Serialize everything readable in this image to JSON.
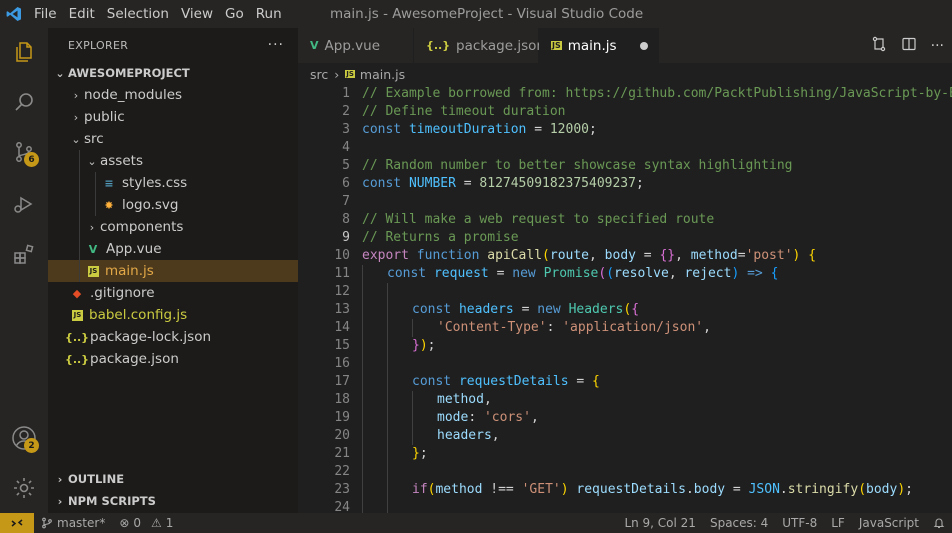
{
  "titlebar": {
    "menu": [
      "File",
      "Edit",
      "Selection",
      "View",
      "Go",
      "Run"
    ],
    "window_title": "main.js - AwesomeProject - Visual Studio Code"
  },
  "activity": {
    "scm_badge": "6",
    "accounts_badge": "2"
  },
  "sidebar": {
    "header": "EXPLORER",
    "more": "···",
    "project": "AWESOMEPROJECT",
    "tree": [
      {
        "label": "node_modules",
        "kind": "folder",
        "depth": 1,
        "open": false
      },
      {
        "label": "public",
        "kind": "folder",
        "depth": 1,
        "open": false
      },
      {
        "label": "src",
        "kind": "folder",
        "depth": 1,
        "open": true
      },
      {
        "label": "assets",
        "kind": "folder",
        "depth": 2,
        "open": true
      },
      {
        "label": "styles.css",
        "kind": "css",
        "depth": 3
      },
      {
        "label": "logo.svg",
        "kind": "svg",
        "depth": 3
      },
      {
        "label": "components",
        "kind": "folder",
        "depth": 2,
        "open": false
      },
      {
        "label": "App.vue",
        "kind": "vue",
        "depth": 2
      },
      {
        "label": "main.js",
        "kind": "js",
        "depth": 2,
        "selected": true
      },
      {
        "label": ".gitignore",
        "kind": "git",
        "depth": 1
      },
      {
        "label": "babel.config.js",
        "kind": "js",
        "depth": 1
      },
      {
        "label": "package-lock.json",
        "kind": "json",
        "depth": 1
      },
      {
        "label": "package.json",
        "kind": "json",
        "depth": 1
      }
    ],
    "sections": [
      "OUTLINE",
      "NPM SCRIPTS"
    ]
  },
  "tabs": [
    {
      "label": "App.vue",
      "icon": "vue-icon"
    },
    {
      "label": "package.json",
      "icon": "json-icon"
    },
    {
      "label": "main.js",
      "icon": "js-icon",
      "active": true,
      "modified": true
    }
  ],
  "breadcrumb": {
    "folder": "src",
    "sep": "›",
    "file": "main.js"
  },
  "editor": {
    "current_line": 9,
    "lines": [
      {
        "n": "1",
        "indent": 0,
        "toks": [
          [
            "com",
            "// Example borrowed from: https://github.com/PacktPublishing/JavaScript-by-Example"
          ]
        ]
      },
      {
        "n": "2",
        "indent": 0,
        "toks": [
          [
            "com",
            "// Define timeout duration"
          ]
        ]
      },
      {
        "n": "3",
        "indent": 0,
        "toks": [
          [
            "kw",
            "const "
          ],
          [
            "const",
            "timeoutDuration"
          ],
          [
            "pun",
            " = "
          ],
          [
            "num",
            "12000"
          ],
          [
            "pun",
            ";"
          ]
        ]
      },
      {
        "n": "4",
        "indent": 0,
        "toks": []
      },
      {
        "n": "5",
        "indent": 0,
        "toks": [
          [
            "com",
            "// Random number to better showcase syntax highlighting"
          ]
        ]
      },
      {
        "n": "6",
        "indent": 0,
        "toks": [
          [
            "kw",
            "const "
          ],
          [
            "const",
            "NUMBER"
          ],
          [
            "pun",
            " = "
          ],
          [
            "num",
            "81274509182375409237"
          ],
          [
            "pun",
            ";"
          ]
        ]
      },
      {
        "n": "7",
        "indent": 0,
        "toks": []
      },
      {
        "n": "8",
        "indent": 0,
        "toks": [
          [
            "com",
            "// Will make a web request to specified route"
          ]
        ]
      },
      {
        "n": "9",
        "indent": 0,
        "toks": [
          [
            "com",
            "// Returns a promise"
          ]
        ]
      },
      {
        "n": "10",
        "indent": 0,
        "toks": [
          [
            "ctl",
            "export "
          ],
          [
            "kw",
            "function "
          ],
          [
            "fn",
            "apiCall"
          ],
          [
            "br1",
            "("
          ],
          [
            "var",
            "route"
          ],
          [
            "pun",
            ", "
          ],
          [
            "var",
            "body"
          ],
          [
            "pun",
            " = "
          ],
          [
            "br2",
            "{}"
          ],
          [
            "pun",
            ", "
          ],
          [
            "var",
            "method"
          ],
          [
            "pun",
            "="
          ],
          [
            "str",
            "'post'"
          ],
          [
            "br1",
            ")"
          ],
          [
            "pun",
            " "
          ],
          [
            "br1",
            "{"
          ]
        ]
      },
      {
        "n": "11",
        "indent": 1,
        "toks": [
          [
            "kw",
            "const "
          ],
          [
            "const",
            "request"
          ],
          [
            "pun",
            " = "
          ],
          [
            "kw",
            "new "
          ],
          [
            "cls",
            "Promise"
          ],
          [
            "br2",
            "("
          ],
          [
            "br3",
            "("
          ],
          [
            "var",
            "resolve"
          ],
          [
            "pun",
            ", "
          ],
          [
            "var",
            "reject"
          ],
          [
            "br3",
            ")"
          ],
          [
            "pun",
            " "
          ],
          [
            "kw",
            "=>"
          ],
          [
            "pun",
            " "
          ],
          [
            "br3",
            "{"
          ]
        ]
      },
      {
        "n": "12",
        "indent": 2,
        "toks": []
      },
      {
        "n": "13",
        "indent": 2,
        "toks": [
          [
            "kw",
            "const "
          ],
          [
            "const",
            "headers"
          ],
          [
            "pun",
            " = "
          ],
          [
            "kw",
            "new "
          ],
          [
            "cls",
            "Headers"
          ],
          [
            "br1",
            "("
          ],
          [
            "br2",
            "{"
          ]
        ]
      },
      {
        "n": "14",
        "indent": 3,
        "toks": [
          [
            "str",
            "'Content-Type'"
          ],
          [
            "pun",
            ": "
          ],
          [
            "str",
            "'application/json'"
          ],
          [
            "pun",
            ","
          ]
        ]
      },
      {
        "n": "15",
        "indent": 2,
        "toks": [
          [
            "br2",
            "}"
          ],
          [
            "br1",
            ")"
          ],
          [
            "pun",
            ";"
          ]
        ]
      },
      {
        "n": "16",
        "indent": 2,
        "toks": []
      },
      {
        "n": "17",
        "indent": 2,
        "toks": [
          [
            "kw",
            "const "
          ],
          [
            "const",
            "requestDetails"
          ],
          [
            "pun",
            " = "
          ],
          [
            "br1",
            "{"
          ]
        ]
      },
      {
        "n": "18",
        "indent": 3,
        "toks": [
          [
            "var",
            "method"
          ],
          [
            "pun",
            ","
          ]
        ]
      },
      {
        "n": "19",
        "indent": 3,
        "toks": [
          [
            "var",
            "mode"
          ],
          [
            "pun",
            ": "
          ],
          [
            "str",
            "'cors'"
          ],
          [
            "pun",
            ","
          ]
        ]
      },
      {
        "n": "20",
        "indent": 3,
        "toks": [
          [
            "var",
            "headers"
          ],
          [
            "pun",
            ","
          ]
        ]
      },
      {
        "n": "21",
        "indent": 2,
        "toks": [
          [
            "br1",
            "}"
          ],
          [
            "pun",
            ";"
          ]
        ]
      },
      {
        "n": "22",
        "indent": 2,
        "toks": []
      },
      {
        "n": "23",
        "indent": 2,
        "toks": [
          [
            "ctl",
            "if"
          ],
          [
            "br1",
            "("
          ],
          [
            "var",
            "method"
          ],
          [
            "pun",
            " !== "
          ],
          [
            "str",
            "'GET'"
          ],
          [
            "br1",
            ")"
          ],
          [
            "pun",
            " "
          ],
          [
            "var",
            "requestDetails"
          ],
          [
            "pun",
            "."
          ],
          [
            "var",
            "body"
          ],
          [
            "pun",
            " = "
          ],
          [
            "const",
            "JSON"
          ],
          [
            "pun",
            "."
          ],
          [
            "fn",
            "stringify"
          ],
          [
            "br1",
            "("
          ],
          [
            "var",
            "body"
          ],
          [
            "br1",
            ")"
          ],
          [
            "pun",
            ";"
          ]
        ]
      },
      {
        "n": "24",
        "indent": 2,
        "toks": []
      }
    ]
  },
  "statusbar": {
    "branch": "master*",
    "errors": "0",
    "warnings": "1",
    "position": "Ln 9, Col 21",
    "spaces": "Spaces: 4",
    "encoding": "UTF-8",
    "eol": "LF",
    "language": "JavaScript"
  },
  "colors": {
    "accent": "#c69817",
    "selected_row": "#4d3a1d",
    "js_icon": "#cbcb41",
    "vue_icon": "#42b883",
    "css_icon": "#519aba"
  }
}
